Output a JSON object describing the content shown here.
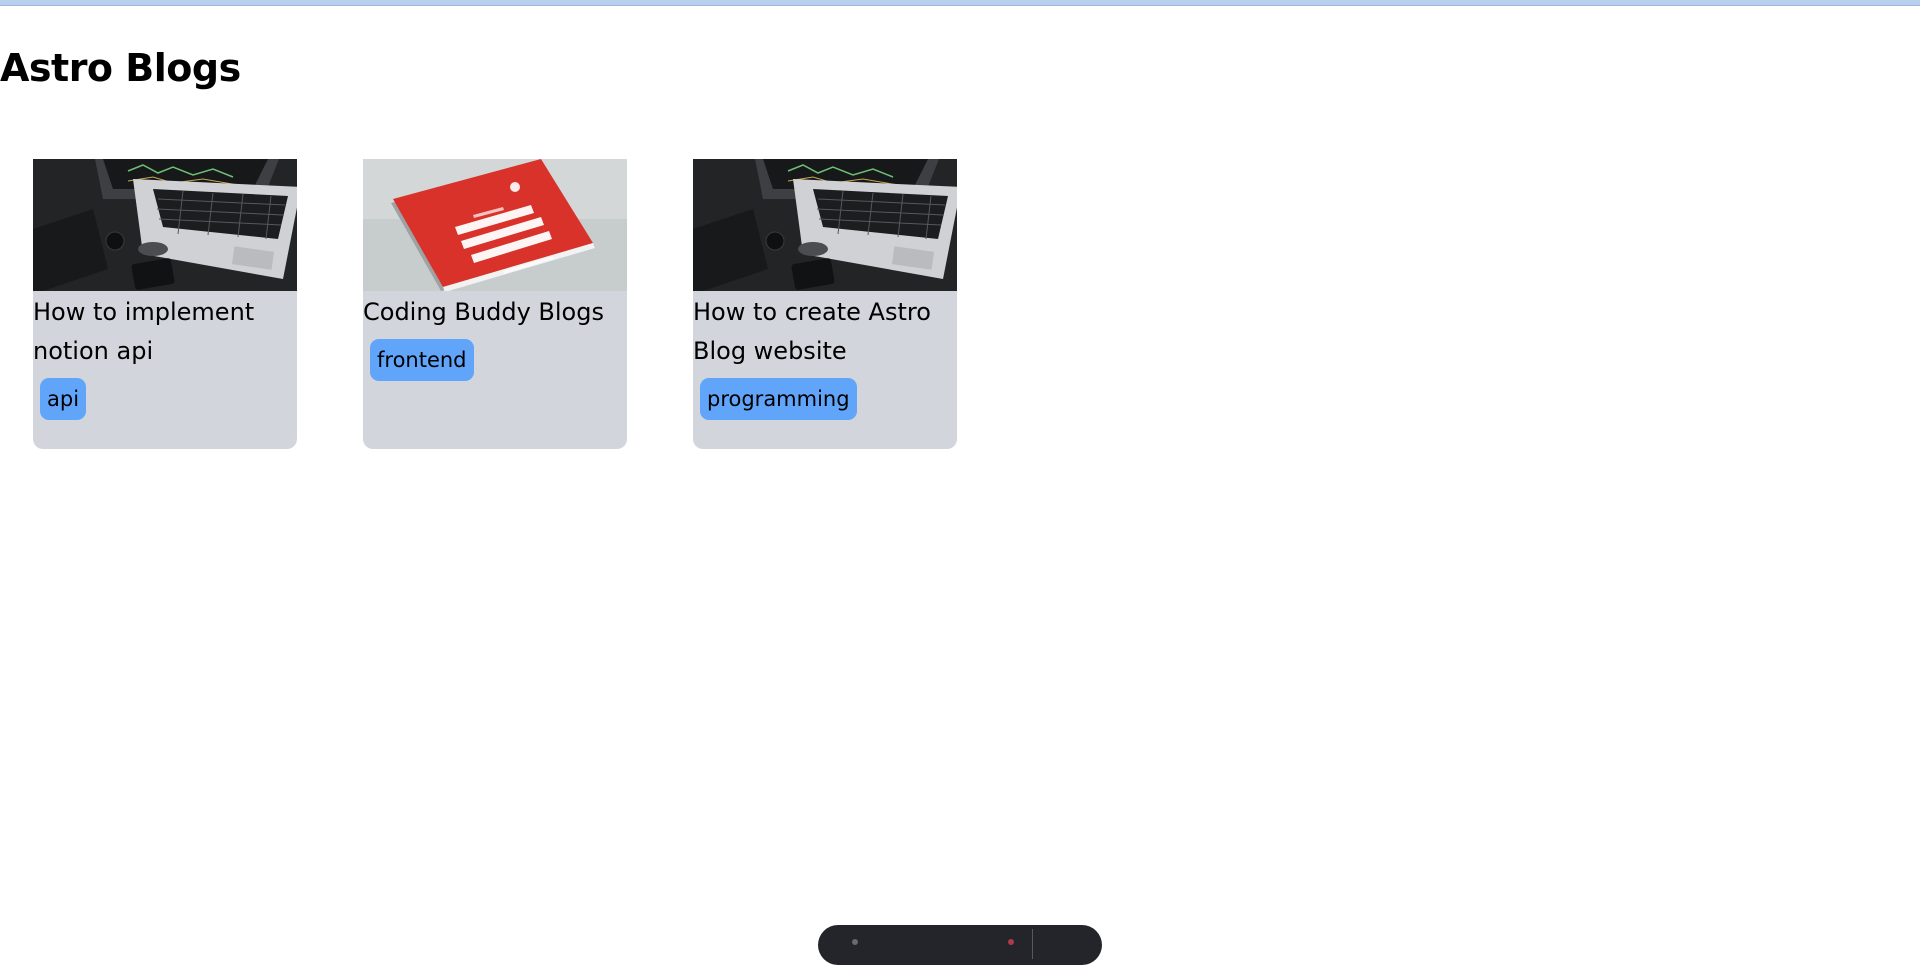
{
  "page": {
    "title": "Astro Blogs"
  },
  "posts": [
    {
      "title": "How to implement notion api",
      "tag": "api",
      "image": "laptop-code-photo"
    },
    {
      "title": "Coding Buddy Blogs",
      "tag": "frontend",
      "image": "javascript-book-photo"
    },
    {
      "title": "How to create Astro Blog website",
      "tag": "programming",
      "image": "laptop-code-photo"
    }
  ],
  "colors": {
    "card_bg": "#d2d5dc",
    "tag_bg": "#60a5fa",
    "book_red": "#d9322a"
  }
}
